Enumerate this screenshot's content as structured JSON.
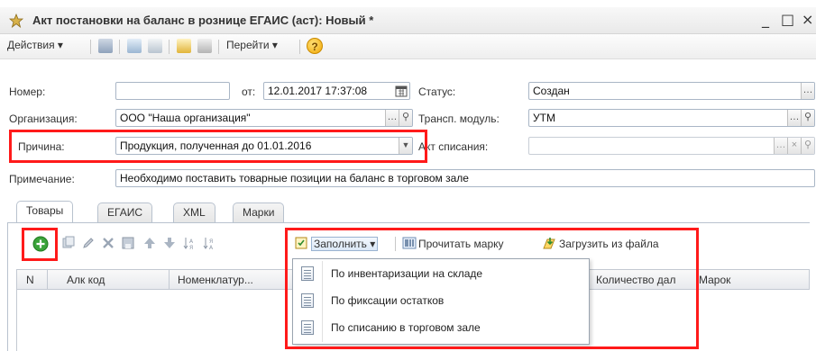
{
  "window": {
    "title": "Акт постановки на баланс в рознице ЕГАИС (аст): Новый *",
    "minimize": "_",
    "maximize": "□",
    "close": "×"
  },
  "toolbar": {
    "actions_label": "Действия ▾",
    "goto_label": "Перейти ▾",
    "help_label": "?"
  },
  "form": {
    "number_label": "Номер:",
    "number_value": "",
    "date_label": "от:",
    "date_value": "12.01.2017 17:37:08",
    "status_label": "Статус:",
    "status_value": "Создан",
    "org_label": "Организация:",
    "org_value": "ООО \"Наша организация\"",
    "transport_label": "Трансп. модуль:",
    "transport_value": "УТМ",
    "reason_label": "Причина:",
    "reason_value": "Продукция, полученная до 01.01.2016",
    "writeoff_label": "Акт списания:",
    "writeoff_value": "",
    "note_label": "Примечание:",
    "note_value": "Необходимо поставить товарные позиции на баланс в торговом зале"
  },
  "tabs": [
    {
      "label": "Товары",
      "active": true
    },
    {
      "label": "ЕГАИС",
      "active": false
    },
    {
      "label": "XML",
      "active": false
    },
    {
      "label": "Марки",
      "active": false
    }
  ],
  "table_toolbar": {
    "fill_label": "Заполнить ▾",
    "read_mark_label": "Прочитать марку",
    "load_file_label": "Загрузить из файла"
  },
  "table": {
    "columns": [
      "N",
      "Алк код",
      "Номенклатур...",
      "Количество дал",
      "Марок"
    ]
  },
  "fill_menu": {
    "items": [
      "По инвентаризации на складе",
      "По фиксации остатков",
      "По списанию в торговом зале"
    ]
  },
  "colors": {
    "highlight": "#ff1a1a",
    "add_icon": "#3aa33a"
  }
}
